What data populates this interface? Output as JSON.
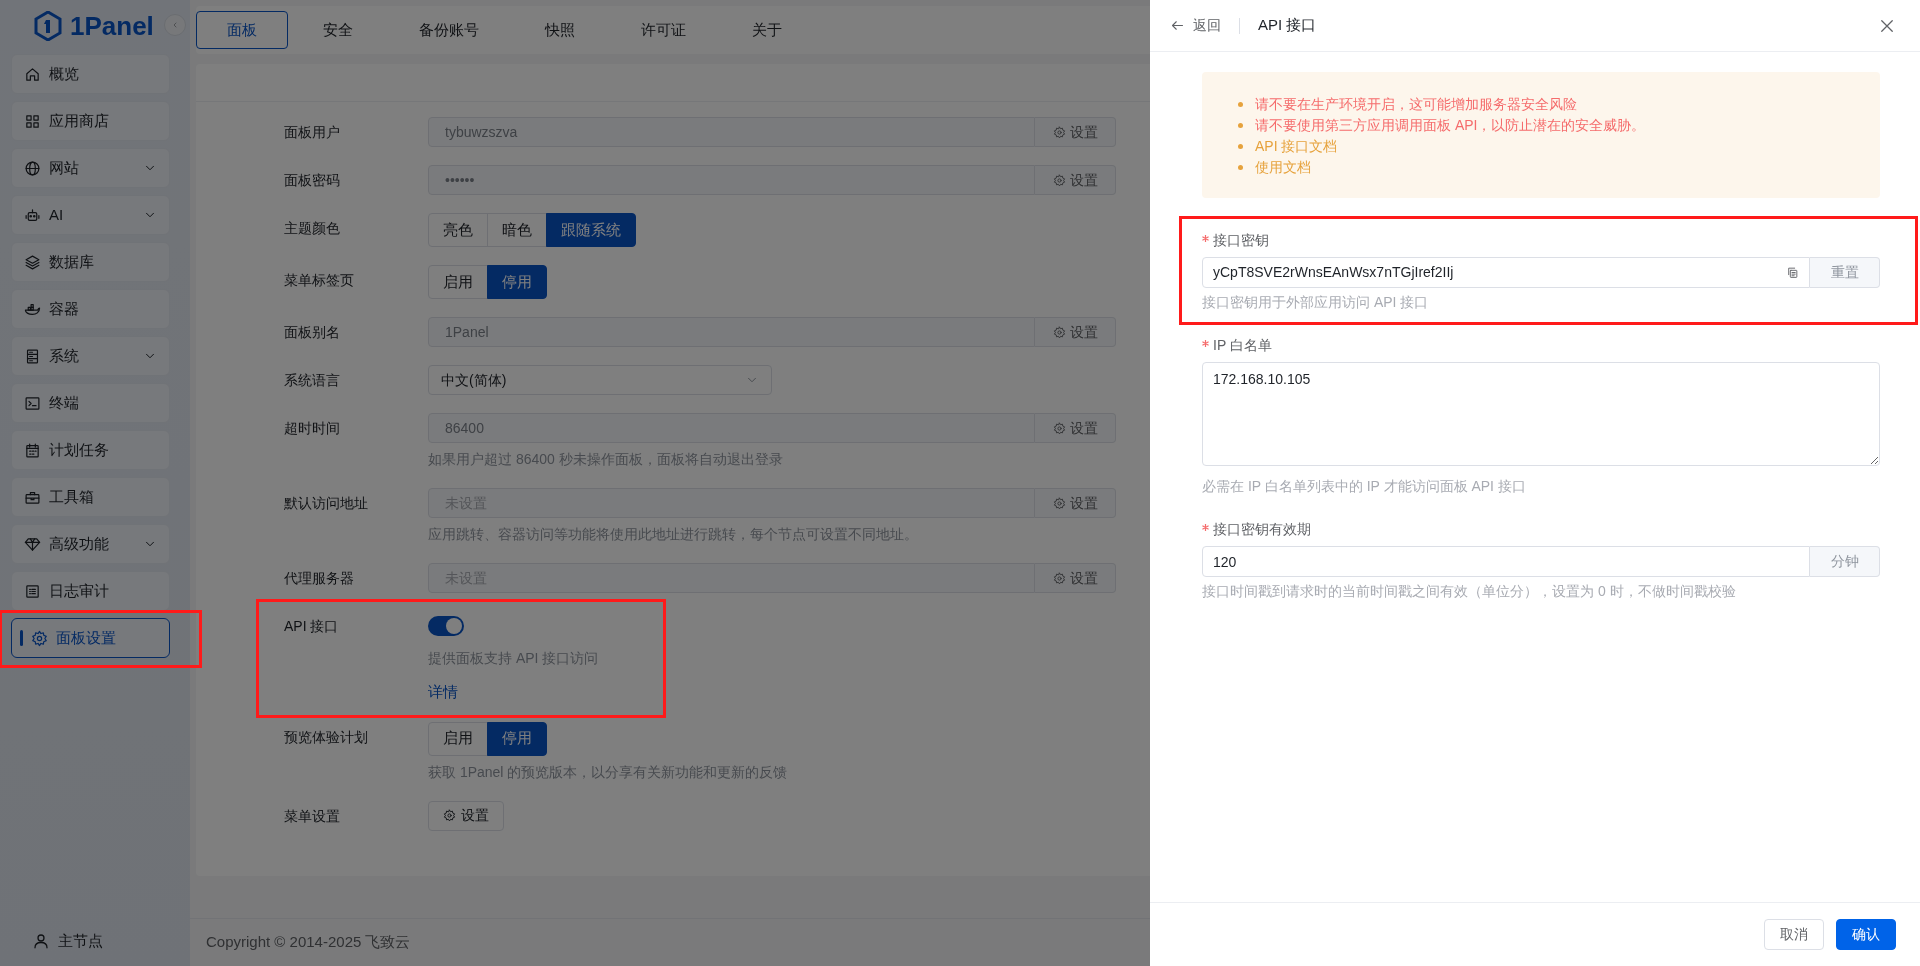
{
  "logo": {
    "text": "1Panel"
  },
  "sidebar": {
    "items": [
      {
        "label": "概览",
        "expandable": false,
        "selected": false,
        "highlighted": false
      },
      {
        "label": "应用商店",
        "expandable": false,
        "selected": false,
        "highlighted": false
      },
      {
        "label": "网站",
        "expandable": true,
        "selected": false,
        "highlighted": false
      },
      {
        "label": "AI",
        "expandable": true,
        "selected": false,
        "highlighted": false
      },
      {
        "label": "数据库",
        "expandable": false,
        "selected": false,
        "highlighted": false
      },
      {
        "label": "容器",
        "expandable": false,
        "selected": false,
        "highlighted": false
      },
      {
        "label": "系统",
        "expandable": true,
        "selected": false,
        "highlighted": false
      },
      {
        "label": "终端",
        "expandable": false,
        "selected": false,
        "highlighted": false
      },
      {
        "label": "计划任务",
        "expandable": false,
        "selected": false,
        "highlighted": false
      },
      {
        "label": "工具箱",
        "expandable": false,
        "selected": false,
        "highlighted": false
      },
      {
        "label": "高级功能",
        "expandable": true,
        "selected": false,
        "highlighted": false
      },
      {
        "label": "日志审计",
        "expandable": false,
        "selected": false,
        "highlighted": false
      },
      {
        "label": "面板设置",
        "expandable": false,
        "selected": true,
        "highlighted": true
      }
    ],
    "footer": {
      "label": "主节点"
    }
  },
  "tabs": [
    {
      "label": "面板",
      "selected": true
    },
    {
      "label": "安全",
      "selected": false
    },
    {
      "label": "备份账号",
      "selected": false
    },
    {
      "label": "快照",
      "selected": false
    },
    {
      "label": "许可证",
      "selected": false
    },
    {
      "label": "关于",
      "selected": false
    }
  ],
  "settings": [
    {
      "kind": "input",
      "label": "面板用户",
      "value": "tybuwzszva",
      "button": "设置"
    },
    {
      "kind": "input",
      "label": "面板密码",
      "value": "••••••",
      "button": "设置"
    },
    {
      "kind": "segmented",
      "label": "主题颜色",
      "options": [
        {
          "label": "亮色",
          "selected": false
        },
        {
          "label": "暗色",
          "selected": false
        },
        {
          "label": "跟随系统",
          "selected": true
        }
      ]
    },
    {
      "kind": "segmented",
      "label": "菜单标签页",
      "options": [
        {
          "label": "启用",
          "selected": false
        },
        {
          "label": "停用",
          "selected": true
        }
      ]
    },
    {
      "kind": "input",
      "label": "面板别名",
      "value": "1Panel",
      "button": "设置"
    },
    {
      "kind": "select",
      "label": "系统语言",
      "value": "中文(简体)"
    },
    {
      "kind": "input",
      "label": "超时时间",
      "value": "86400",
      "button": "设置",
      "hint": "如果用户超过 86400 秒未操作面板，面板将自动退出登录"
    },
    {
      "kind": "input",
      "label": "默认访问地址",
      "placeholder": "未设置",
      "button": "设置",
      "hint": "应用跳转、容器访问等功能将使用此地址进行跳转，每个节点可设置不同地址。"
    },
    {
      "kind": "input",
      "label": "代理服务器",
      "placeholder": "未设置",
      "button": "设置"
    },
    {
      "kind": "switch",
      "label": "API 接口",
      "on": true,
      "hint": "提供面板支持 API 接口访问",
      "link": "详情",
      "highlighted": true
    },
    {
      "kind": "segmented",
      "label": "预览体验计划",
      "options": [
        {
          "label": "启用",
          "selected": false
        },
        {
          "label": "停用",
          "selected": true
        }
      ],
      "hint": "获取 1Panel 的预览版本，以分享有关新功能和更新的反馈"
    },
    {
      "kind": "button",
      "label": "菜单设置",
      "button": "设置"
    }
  ],
  "footer": {
    "text": "Copyright © 2014-2025 飞致云"
  },
  "drawer": {
    "back": "返回",
    "title": "API 接口",
    "notices": [
      {
        "kind": "warning",
        "text": "请不要在生产环境开启，这可能增加服务器安全风险"
      },
      {
        "kind": "warning",
        "text": "请不要使用第三方应用调用面板 API，以防止潜在的安全威胁。"
      },
      {
        "kind": "link",
        "text": "API 接口文档"
      },
      {
        "kind": "link",
        "text": "使用文档"
      }
    ],
    "fields": [
      {
        "kind": "key",
        "label": "接口密钥",
        "required": true,
        "value": "yCpT8SVE2rWnsEAnWsx7nTGjIref2IIj",
        "button": "重置",
        "hint": "接口密钥用于外部应用访问 API 接口",
        "highlighted": true
      },
      {
        "kind": "textarea",
        "label": "IP 白名单",
        "required": true,
        "value": "172.168.10.105",
        "hint": "必需在 IP 白名单列表中的 IP 才能访问面板 API 接口"
      },
      {
        "kind": "unit",
        "label": "接口密钥有效期",
        "required": true,
        "value": "120",
        "unit": "分钟",
        "hint": "接口时间戳到请求时的当前时间戳之间有效（单位分），设置为 0 时，不做时间戳校验"
      }
    ],
    "buttons": [
      {
        "kind": "secondary",
        "label": "取消"
      },
      {
        "kind": "primary",
        "label": "确认"
      }
    ]
  }
}
